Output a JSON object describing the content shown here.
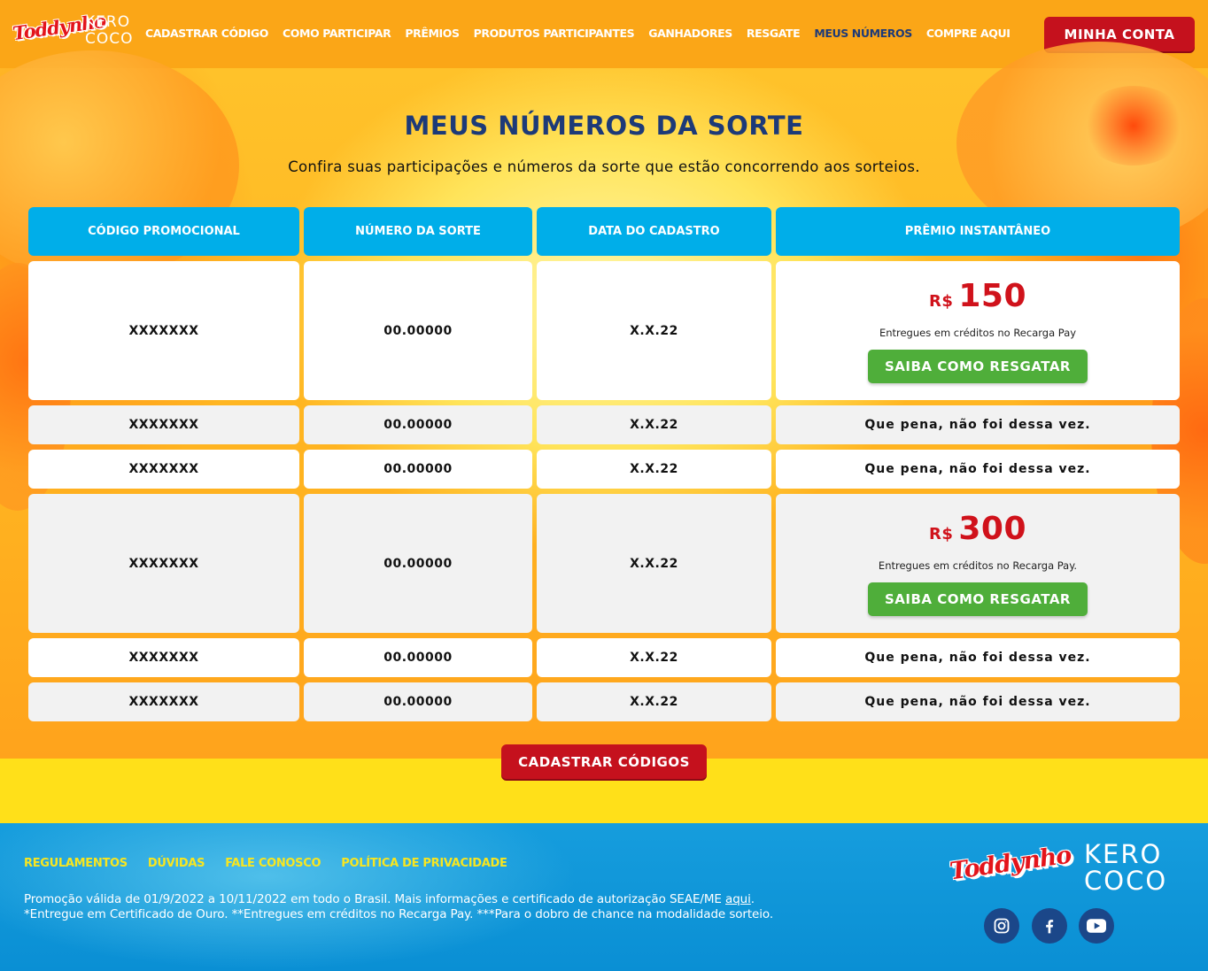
{
  "header": {
    "logo_toddynho": "Toddynho",
    "logo_kerococo": "KERO COCO",
    "nav": [
      {
        "label": "CADASTRAR CÓDIGO",
        "active": false
      },
      {
        "label": "COMO PARTICIPAR",
        "active": false
      },
      {
        "label": "PRÊMIOS",
        "active": false
      },
      {
        "label": "PRODUTOS PARTICIPANTES",
        "active": false
      },
      {
        "label": "GANHADORES",
        "active": false
      },
      {
        "label": "RESGATE",
        "active": false
      },
      {
        "label": "MEUS NÚMEROS",
        "active": true
      },
      {
        "label": "COMPRE AQUI",
        "active": false
      }
    ],
    "account_button": "MINHA CONTA"
  },
  "main": {
    "title": "MEUS NÚMEROS DA SORTE",
    "subtitle": "Confira suas participações e números da sorte que estão concorrendo aos sorteios.",
    "table": {
      "columns": [
        "CÓDIGO PROMOCIONAL",
        "NÚMERO DA SORTE",
        "DATA DO CADASTRO",
        "PRÊMIO INSTANTÂNEO"
      ],
      "rows": [
        {
          "code": "XXXXXXX",
          "number": "00.00000",
          "date": "X.X.22",
          "prize": {
            "currency": "R$",
            "amount": "150",
            "note": "Entregues em créditos no Recarga Pay",
            "button": "SAIBA COMO RESGATAR"
          }
        },
        {
          "code": "XXXXXXX",
          "number": "00.00000",
          "date": "X.X.22",
          "result": "Que pena, não foi dessa vez."
        },
        {
          "code": "XXXXXXX",
          "number": "00.00000",
          "date": "X.X.22",
          "result": "Que pena, não foi dessa vez."
        },
        {
          "code": "XXXXXXX",
          "number": "00.00000",
          "date": "X.X.22",
          "prize": {
            "currency": "R$",
            "amount": "300",
            "note": "Entregues em créditos no Recarga Pay.",
            "button": "SAIBA COMO RESGATAR"
          }
        },
        {
          "code": "XXXXXXX",
          "number": "00.00000",
          "date": "X.X.22",
          "result": "Que pena, não foi dessa vez."
        },
        {
          "code": "XXXXXXX",
          "number": "00.00000",
          "date": "X.X.22",
          "result": "Que pena, não foi dessa vez."
        }
      ]
    },
    "register_button": "CADASTRAR CÓDIGOS"
  },
  "footer": {
    "links": [
      "REGULAMENTOS",
      "DÚVIDAS",
      "FALE CONOSCO",
      "POLÍTICA DE PRIVACIDADE"
    ],
    "legal_line1": "Promoção válida de 01/9/2022 a 10/11/2022 em todo o Brasil. Mais informações e certificado de autorização SEAE/ME ",
    "legal_link": "aqui",
    "legal_line1_end": ".",
    "legal_line2": "*Entregue em Certificado de Ouro. **Entregues em créditos no Recarga Pay. ***Para o dobro de chance na modalidade sorteio.",
    "logo_toddynho": "Toddynho",
    "logo_kerococo": "KERO COCO",
    "social": [
      "instagram-icon",
      "facebook-icon",
      "youtube-icon"
    ]
  },
  "colors": {
    "header_bg": "#fba617",
    "nav_active": "#1d3a78",
    "primary_red": "#c5111d",
    "table_header": "#00aee9",
    "claim_green": "#4fae3a",
    "prize_red": "#d0121b",
    "footer_bg": "#0a8fd4",
    "footer_link": "#f8e620"
  }
}
